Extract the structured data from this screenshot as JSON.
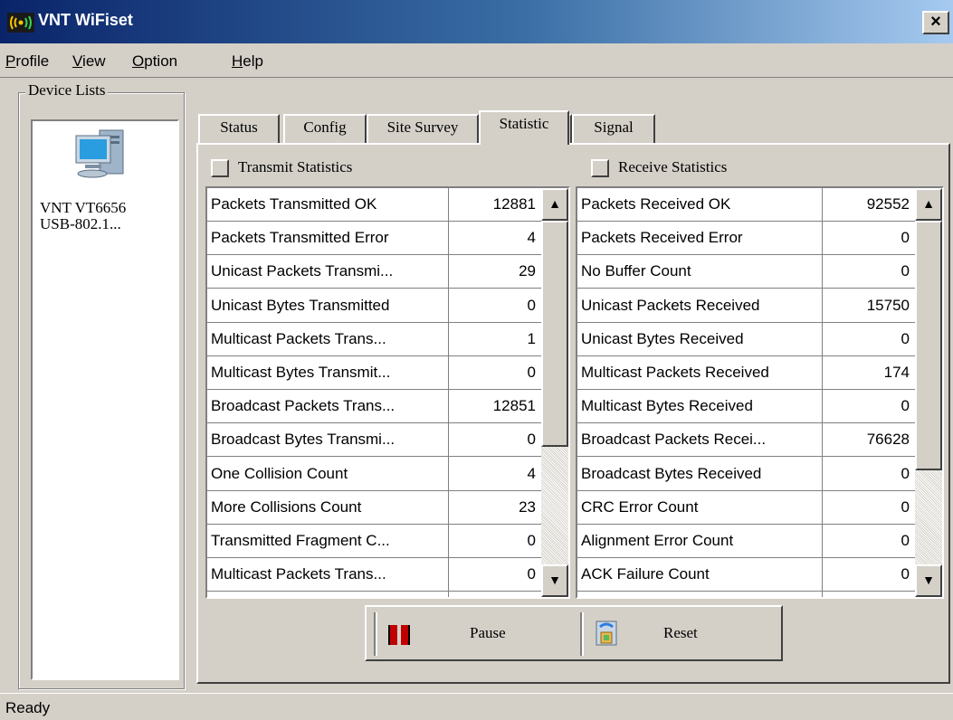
{
  "window": {
    "title": "VNT WiFiset",
    "close_glyph": "×"
  },
  "menu": {
    "items": [
      {
        "first": "P",
        "rest": "rofile"
      },
      {
        "first": "V",
        "rest": "iew"
      },
      {
        "first": "O",
        "rest": "ption"
      },
      {
        "first": "H",
        "rest": "elp"
      }
    ]
  },
  "device_list": {
    "label": "Device Lists",
    "icon": "computer-icon",
    "device_line1": "VNT VT6656",
    "device_line2": "USB-802.1..."
  },
  "tabs": [
    "Status",
    "Config",
    "Site Survey",
    "Statistic",
    "Signal"
  ],
  "active_tab": "Statistic",
  "transmit": {
    "header": "Transmit Statistics",
    "rows": [
      {
        "name": "Packets Transmitted OK",
        "value": "12881"
      },
      {
        "name": "Packets Transmitted Error",
        "value": "4"
      },
      {
        "name": "Unicast Packets Transmi...",
        "value": "29"
      },
      {
        "name": "Unicast Bytes Transmitted",
        "value": "0"
      },
      {
        "name": "Multicast Packets Trans...",
        "value": "1"
      },
      {
        "name": "Multicast Bytes Transmit...",
        "value": "0"
      },
      {
        "name": "Broadcast Packets Trans...",
        "value": "12851"
      },
      {
        "name": "Broadcast Bytes Transmi...",
        "value": "0"
      },
      {
        "name": "One Collision Count",
        "value": "4"
      },
      {
        "name": "More Collisions Count",
        "value": "23"
      },
      {
        "name": "Transmitted Fragment C...",
        "value": "0"
      },
      {
        "name": "Multicast Packets Trans...",
        "value": "0"
      }
    ]
  },
  "receive": {
    "header": "Receive Statistics",
    "rows": [
      {
        "name": "Packets Received OK",
        "value": "92552"
      },
      {
        "name": "Packets Received Error",
        "value": "0"
      },
      {
        "name": "No Buffer Count",
        "value": "0"
      },
      {
        "name": "Unicast Packets Received",
        "value": "15750"
      },
      {
        "name": "Unicast Bytes Received",
        "value": "0"
      },
      {
        "name": "Multicast Packets Received",
        "value": "174"
      },
      {
        "name": "Multicast Bytes Received",
        "value": "0"
      },
      {
        "name": "Broadcast Packets Recei...",
        "value": "76628"
      },
      {
        "name": "Broadcast Bytes Received",
        "value": "0"
      },
      {
        "name": "CRC Error Count",
        "value": "0"
      },
      {
        "name": "Alignment Error Count",
        "value": "0"
      },
      {
        "name": "ACK Failure Count",
        "value": "0"
      }
    ]
  },
  "buttons": {
    "pause_label": "Pause",
    "reset_label": "Reset",
    "pause_icon": "pause-icon",
    "reset_icon": "reset-icon"
  },
  "status_bar": {
    "text": "Ready"
  },
  "colors": {
    "title_start": "#0a246a",
    "title_end": "#a6caf0",
    "face": "#d4d0c8",
    "pause_red": "#c00000"
  }
}
